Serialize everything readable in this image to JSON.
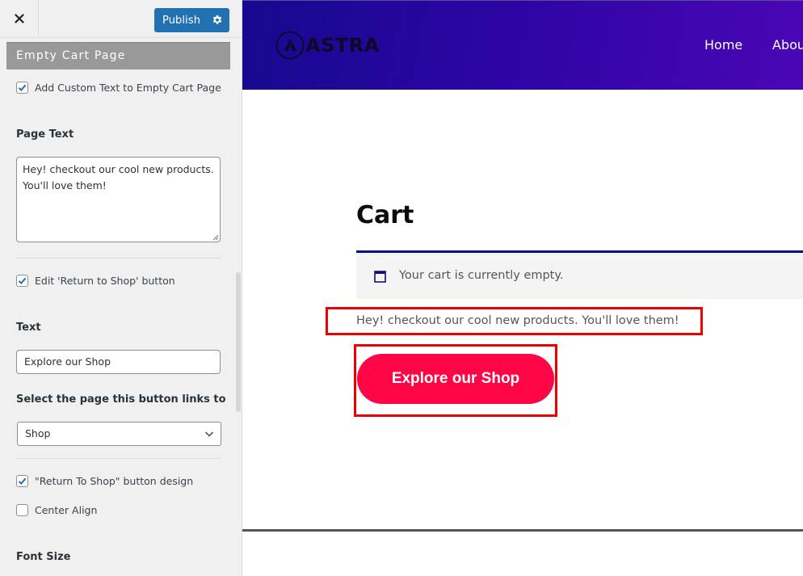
{
  "customizer": {
    "close_label": "Close",
    "publish_label": "Publish",
    "section_title": "Empty Cart Page",
    "add_custom_text": {
      "label": "Add Custom Text to Empty Cart Page",
      "checked": true
    },
    "page_text": {
      "title": "Page Text",
      "value": "Hey! checkout our cool new products. You'll love them!"
    },
    "edit_return_button": {
      "label": "Edit 'Return to Shop' button",
      "checked": true
    },
    "text_field": {
      "title": "Text",
      "value": "Explore our Shop"
    },
    "link_select": {
      "title": "Select the page this button links to",
      "selected": "Shop"
    },
    "button_design": {
      "label": "\"Return To Shop\" button design",
      "checked": true
    },
    "center_align": {
      "label": "Center Align",
      "checked": false
    },
    "font_size_title": "Font Size"
  },
  "preview": {
    "logo_text": "ASTRA",
    "nav": [
      "Home",
      "Abou"
    ],
    "page_title": "Cart",
    "notice_text": "Your cart is currently empty.",
    "custom_text": "Hey! checkout our cool new products. You'll love them!",
    "shop_button_label": "Explore our Shop"
  },
  "colors": {
    "publish": "#2271b1",
    "header_gradient_start": "#160a8f",
    "header_gradient_end": "#4a06b5",
    "shop_button": "#ff0545",
    "highlight": "#ee0000",
    "notice_border": "#0b0b7d"
  }
}
